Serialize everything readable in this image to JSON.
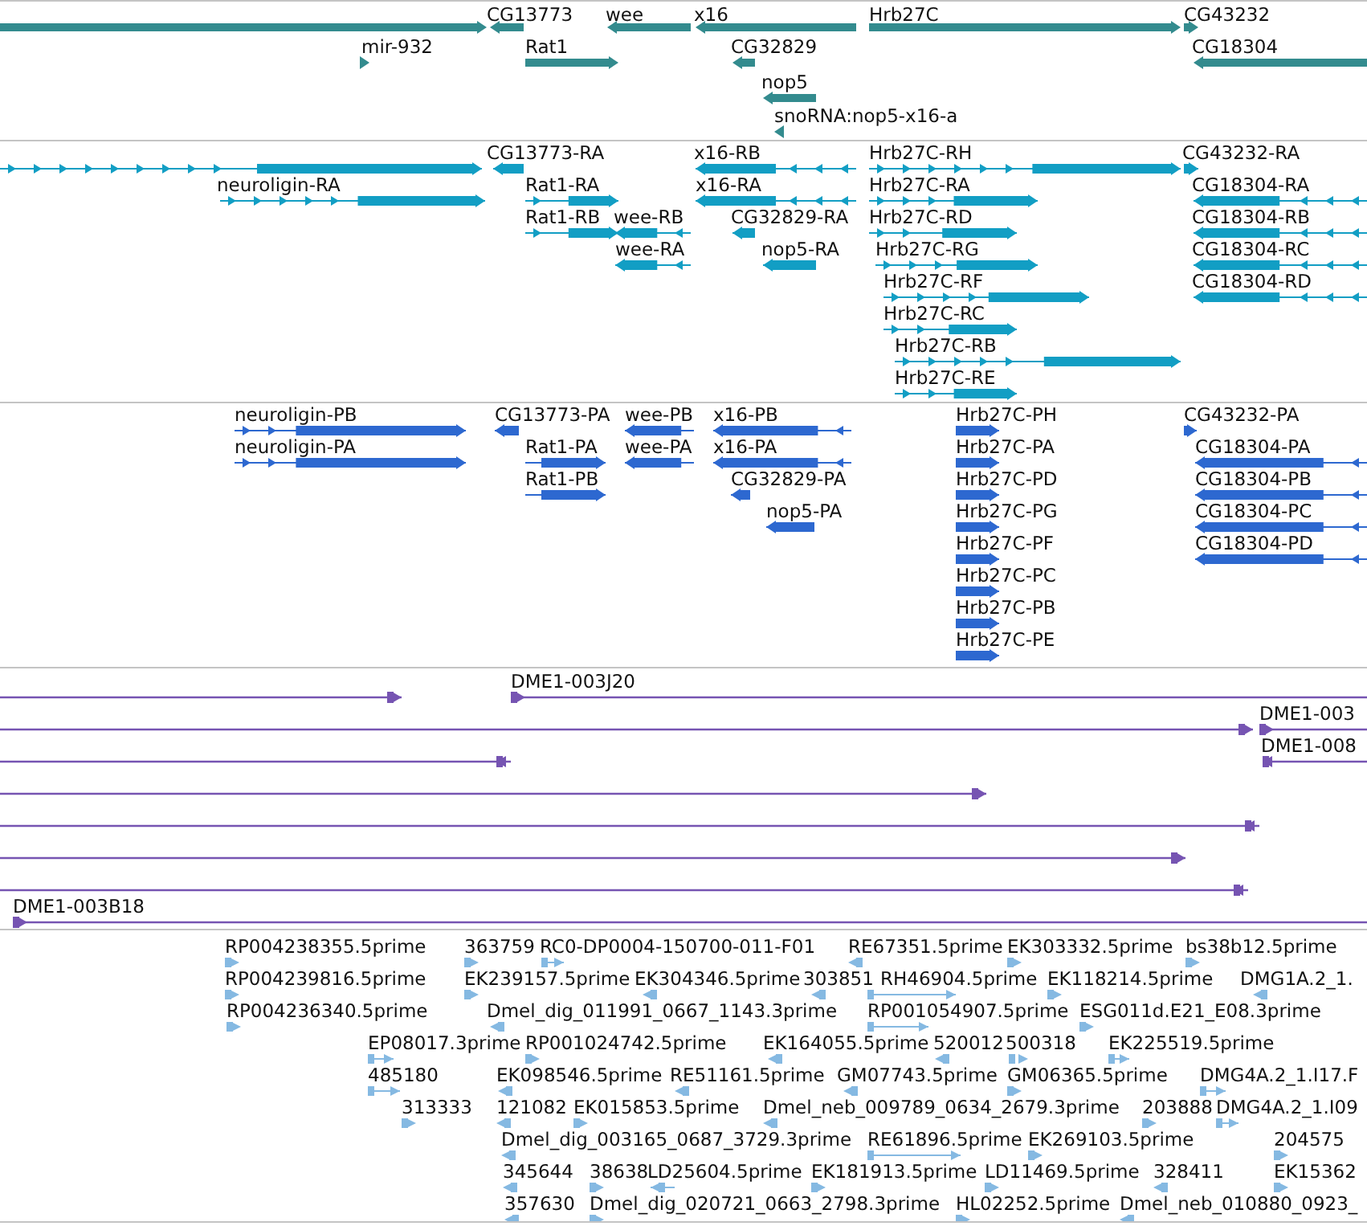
{
  "tracks": [
    {
      "kind": "gene",
      "color": "#338b8e",
      "features": [
        {
          "reverse": false
        },
        {
          "label": "CG13773",
          "reverse": true
        },
        {
          "label": "wee",
          "reverse": true
        },
        {
          "label": "x16",
          "reverse": true
        },
        {
          "label": "Hrb27C",
          "reverse": false
        },
        {
          "label": "CG43232",
          "reverse": false
        },
        {
          "label": "mir-932",
          "reverse": false
        },
        {
          "label": "Rat1",
          "reverse": false
        },
        {
          "label": "CG32829",
          "reverse": true
        },
        {
          "label": "CG18304",
          "reverse": true
        },
        {
          "label": "nop5",
          "reverse": true
        },
        {
          "label": "snoRNA:nop5-x16-a",
          "reverse": true
        }
      ]
    },
    {
      "kind": "transcript",
      "color": "#129ec4",
      "features": [
        {
          "reverse": false
        },
        {
          "label": "CG13773-RA",
          "reverse": true
        },
        {
          "label": "x16-RB",
          "reverse": true
        },
        {
          "label": "Hrb27C-RH",
          "reverse": false
        },
        {
          "label": "CG43232-RA",
          "reverse": false
        },
        {
          "label": "neuroligin-RA",
          "reverse": false
        },
        {
          "label": "Rat1-RA",
          "reverse": false
        },
        {
          "label": "x16-RA",
          "reverse": true
        },
        {
          "label": "Hrb27C-RA",
          "reverse": false
        },
        {
          "label": "CG18304-RA",
          "reverse": true
        },
        {
          "label": "Rat1-RB",
          "reverse": false
        },
        {
          "label": "wee-RB",
          "reverse": true
        },
        {
          "label": "CG32829-RA",
          "reverse": true
        },
        {
          "label": "Hrb27C-RD",
          "reverse": false
        },
        {
          "label": "CG18304-RB",
          "reverse": true
        },
        {
          "label": "wee-RA",
          "reverse": true
        },
        {
          "label": "nop5-RA",
          "reverse": true
        },
        {
          "label": "Hrb27C-RG",
          "reverse": false
        },
        {
          "label": "CG18304-RC",
          "reverse": true
        },
        {
          "label": "Hrb27C-RF",
          "reverse": false
        },
        {
          "label": "CG18304-RD",
          "reverse": true
        },
        {
          "label": "Hrb27C-RC",
          "reverse": false
        },
        {
          "label": "Hrb27C-RB",
          "reverse": false
        },
        {
          "label": "Hrb27C-RE",
          "reverse": false
        }
      ]
    },
    {
      "kind": "protein",
      "color": "#2d68d0",
      "features": [
        {
          "label": "neuroligin-PB",
          "reverse": false
        },
        {
          "label": "CG13773-PA",
          "reverse": true
        },
        {
          "label": "wee-PB",
          "reverse": true
        },
        {
          "label": "x16-PB",
          "reverse": true
        },
        {
          "label": "Hrb27C-PH",
          "reverse": false
        },
        {
          "label": "CG43232-PA",
          "reverse": false
        },
        {
          "label": "neuroligin-PA",
          "reverse": false
        },
        {
          "label": "Rat1-PA",
          "reverse": false
        },
        {
          "label": "wee-PA",
          "reverse": true
        },
        {
          "label": "x16-PA",
          "reverse": true
        },
        {
          "label": "Hrb27C-PA",
          "reverse": false
        },
        {
          "label": "CG18304-PA",
          "reverse": true
        },
        {
          "label": "Rat1-PB",
          "reverse": false
        },
        {
          "label": "CG32829-PA",
          "reverse": true
        },
        {
          "label": "Hrb27C-PD",
          "reverse": false
        },
        {
          "label": "CG18304-PB",
          "reverse": true
        },
        {
          "label": "nop5-PA",
          "reverse": true
        },
        {
          "label": "Hrb27C-PG",
          "reverse": false
        },
        {
          "label": "CG18304-PC",
          "reverse": true
        },
        {
          "label": "Hrb27C-PF",
          "reverse": false
        },
        {
          "label": "CG18304-PD",
          "reverse": true
        },
        {
          "label": "Hrb27C-PC",
          "reverse": false
        },
        {
          "label": "Hrb27C-PB",
          "reverse": false
        },
        {
          "label": "Hrb27C-PE",
          "reverse": false
        }
      ]
    },
    {
      "kind": "clone",
      "color": "#7654b2",
      "features": [
        {
          "reverse": false
        },
        {
          "label": "DME1-003J20",
          "reverse": false
        },
        {
          "reverse": false
        },
        {
          "label": "DME1-003",
          "reverse": false
        },
        {
          "reverse": true
        },
        {
          "label": "DME1-008",
          "reverse": true
        },
        {
          "reverse": false
        },
        {
          "reverse": true
        },
        {
          "reverse": false
        },
        {
          "reverse": true
        },
        {
          "label": "DME1-003B18",
          "reverse": false
        }
      ]
    },
    {
      "kind": "est",
      "color": "#85b9e2",
      "features": [
        {
          "label": "RP004238355.5prime",
          "reverse": false
        },
        {
          "label": "363759",
          "reverse": false
        },
        {
          "label": "RC0-DP0004-150700-011-F01",
          "reverse": false
        },
        {
          "label": "RE67351.5prime",
          "reverse": true
        },
        {
          "label": "EK303332.5prime",
          "reverse": false
        },
        {
          "label": "bs38b12.5prime",
          "reverse": false
        },
        {
          "label": "RP004239816.5prime",
          "reverse": false
        },
        {
          "label": "EK239157.5prime",
          "reverse": false
        },
        {
          "label": "EK304346.5prime",
          "reverse": true
        },
        {
          "label": "303851",
          "reverse": true
        },
        {
          "label": "RH46904.5prime",
          "reverse": false
        },
        {
          "label": "EK118214.5prime",
          "reverse": false
        },
        {
          "label": "DMG1A.2_1.",
          "reverse": true
        },
        {
          "label": "RP004236340.5prime",
          "reverse": false
        },
        {
          "label": "Dmel_dig_011991_0667_1143.3prime",
          "reverse": true
        },
        {
          "label": "RP001054907.5prime",
          "reverse": false
        },
        {
          "label": "ESG011d.E21_E08.3prime",
          "reverse": false
        },
        {
          "label": "EP08017.3prime",
          "reverse": false
        },
        {
          "label": "RP001024742.5prime",
          "reverse": false
        },
        {
          "label": "EK164055.5prime",
          "reverse": true
        },
        {
          "label": "520012",
          "reverse": true
        },
        {
          "label": "500318",
          "reverse": false
        },
        {
          "label": "EK225519.5prime",
          "reverse": false
        },
        {
          "label": "485180",
          "reverse": false
        },
        {
          "label": "EK098546.5prime",
          "reverse": true
        },
        {
          "label": "RE51161.5prime",
          "reverse": true
        },
        {
          "label": "GM07743.5prime",
          "reverse": true
        },
        {
          "label": "GM06365.5prime",
          "reverse": false
        },
        {
          "label": "DMG4A.2_1.I17.F",
          "reverse": false
        },
        {
          "label": "313333",
          "reverse": false
        },
        {
          "label": "121082",
          "reverse": true
        },
        {
          "label": "EK015853.5prime",
          "reverse": false
        },
        {
          "label": "Dmel_neb_009789_0634_2679.3prime",
          "reverse": true
        },
        {
          "label": "203888",
          "reverse": false
        },
        {
          "label": "DMG4A.2_1.I09",
          "reverse": false
        },
        {
          "label": "Dmel_dig_003165_0687_3729.3prime",
          "reverse": true
        },
        {
          "label": "RE61896.5prime",
          "reverse": false
        },
        {
          "label": "EK269103.5prime",
          "reverse": false
        },
        {
          "label": "204575",
          "reverse": false
        },
        {
          "label": "345644",
          "reverse": true
        },
        {
          "label": "38638",
          "reverse": false
        },
        {
          "label": "LD25604.5prime",
          "reverse": true
        },
        {
          "label": "EK181913.5prime",
          "reverse": false
        },
        {
          "label": "LD11469.5prime",
          "reverse": false
        },
        {
          "label": "328411",
          "reverse": true
        },
        {
          "label": "EK15362",
          "reverse": false
        },
        {
          "label": "357630",
          "reverse": true
        },
        {
          "label": "Dmel_dig_020721_0663_2798.3prime",
          "reverse": false
        },
        {
          "label": "HL02252.5prime",
          "reverse": false
        },
        {
          "label": "Dmel_neb_010880_0923_",
          "reverse": true
        }
      ]
    }
  ]
}
